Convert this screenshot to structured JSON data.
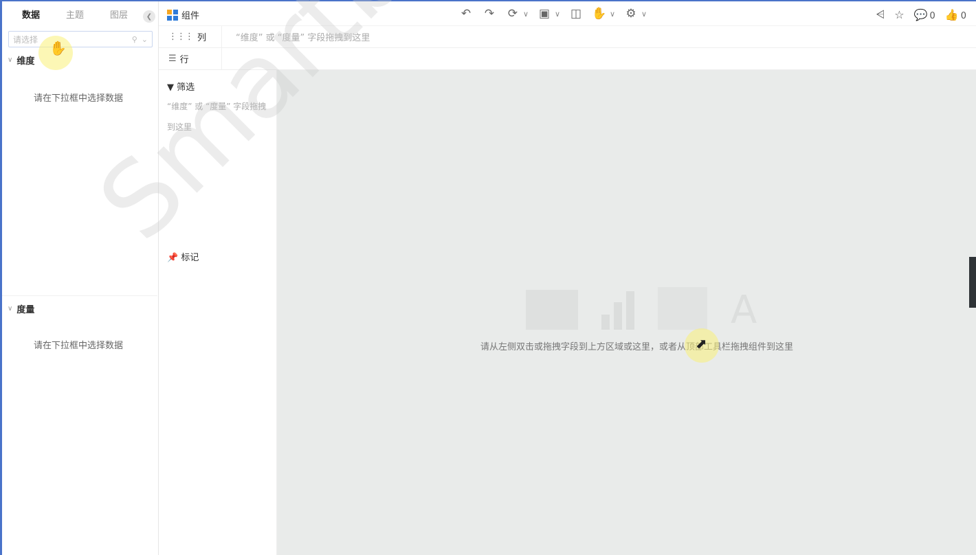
{
  "left_panel": {
    "tabs": [
      "数据",
      "主题",
      "图层"
    ],
    "active_tab": "数据",
    "collapse_icon": "chevron-left-icon",
    "select_placeholder": "请选择",
    "dimension_title": "维度",
    "dimension_empty": "请在下拉框中选择数据",
    "measure_title": "度量",
    "measure_empty": "请在下拉框中选择数据"
  },
  "toolbar": {
    "component_label": "组件",
    "component_icon_colors": [
      "#f5a623",
      "#2f7bd9",
      "#2f7bd9",
      "#2f7bd9"
    ],
    "tools": [
      "undo-icon",
      "redo-icon",
      "refresh-icon",
      "save-icon",
      "preview-icon",
      "pan-icon",
      "settings-icon"
    ],
    "share_icon": "share-icon",
    "favorite_icon": "star-icon",
    "comment_count": "0",
    "like_count": "0"
  },
  "shelves": {
    "columns_label": "列",
    "columns_hint": "“维度” 或 “度量” 字段拖拽到这里",
    "rows_label": "行"
  },
  "marks_panel": {
    "filter_label": "筛选",
    "filter_hint": "“维度” 或 “度量” 字段拖拽到这里",
    "marks_label": "标记"
  },
  "canvas": {
    "tip": "请从左侧双击或拖拽字段到上方区域或这里，或者从顶部工具栏拖拽组件到这里",
    "background": "#e9ebea",
    "illustration_letter": "A"
  },
  "watermark": "Smartbi"
}
